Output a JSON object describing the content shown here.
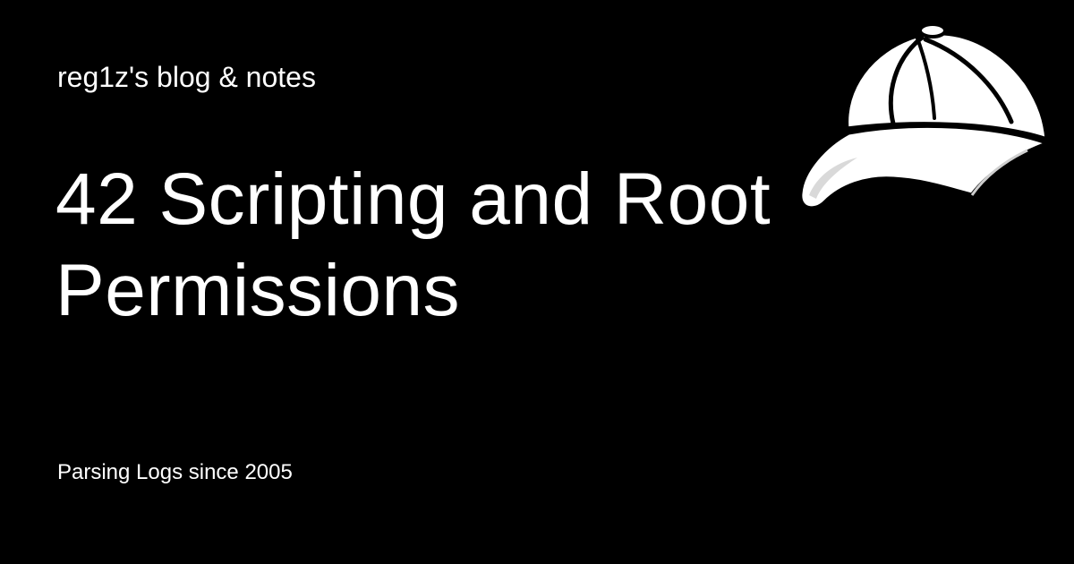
{
  "card": {
    "site_name": "reg1z's blog & notes",
    "title": "42 Scripting and Root Permissions",
    "tagline": "Parsing Logs since 2005",
    "logo_icon": "baseball-cap-icon",
    "background_color": "#000000",
    "text_color": "#ffffff"
  }
}
